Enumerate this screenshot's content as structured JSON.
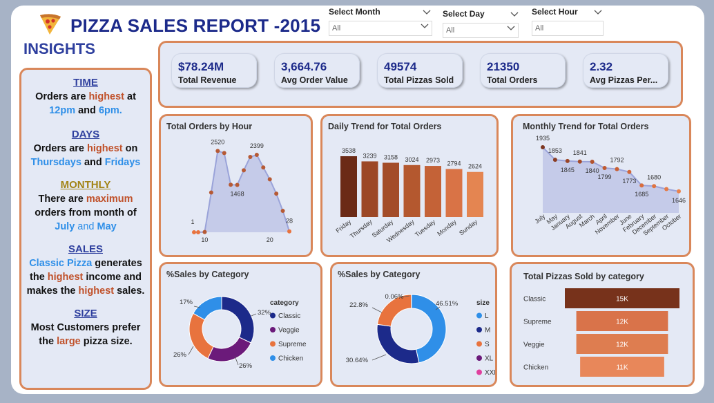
{
  "header": {
    "title": "PIZZA SALES REPORT -2015",
    "slicers": [
      {
        "label": "Select Month",
        "value": "All"
      },
      {
        "label": "Select Day",
        "value": "All"
      },
      {
        "label": "Select Hour",
        "value": "All"
      }
    ]
  },
  "insights": {
    "heading": "INSIGHTS",
    "time": {
      "h": "TIME",
      "a": "Orders are ",
      "b": "highest",
      "c": " at",
      "d": "12pm",
      "e": " and ",
      "f": "6pm."
    },
    "days": {
      "h": "DAYS ",
      "a": "Orders are ",
      "b": "highest",
      "c": " on",
      "d": "Thursdays",
      "e": " and ",
      "f": "Fridays"
    },
    "monthly": {
      "h": "MONTHLY",
      "a": "There are ",
      "b": "maximum",
      "c": "orders from month of",
      "d": "July",
      "e": " and ",
      "f": "May"
    },
    "sales": {
      "h": "SALES",
      "a": "Classic Pizza",
      "b": " generates",
      "c": "the ",
      "d": "highest",
      "e": " income and",
      "f": "makes the ",
      "g": "highest",
      "i": " sales."
    },
    "size": {
      "h": "SIZE",
      "a": "Most Customers prefer",
      "b": "the ",
      "c": "large",
      "d": " pizza size."
    }
  },
  "kpis": [
    {
      "value": "$78.24M",
      "label": "Total Revenue"
    },
    {
      "value": "3,664.76",
      "label": "Avg Order Value"
    },
    {
      "value": "49574",
      "label": "Total Pizzas Sold"
    },
    {
      "value": "21350",
      "label": "Total Orders"
    },
    {
      "value": "2.32",
      "label": "Avg Pizzas Per..."
    }
  ],
  "colors": {
    "navy": "#1c2a8a",
    "orange_border": "#d9875a",
    "panel_bg": "#e4e9f5"
  },
  "chart_data": [
    {
      "id": "hour",
      "type": "area",
      "title": "Total Orders by Hour",
      "x": [
        9,
        10,
        11,
        12,
        13,
        14,
        15,
        16,
        17,
        18,
        19,
        20,
        21,
        22,
        23
      ],
      "values": [
        1,
        8,
        1231,
        2520,
        2455,
        1472,
        1468,
        1920,
        2336,
        2399,
        2009,
        1642,
        1198,
        663,
        28
      ],
      "data_labels": [
        {
          "x": 9,
          "text": "1"
        },
        {
          "x": 12,
          "text": "2520"
        },
        {
          "x": 15,
          "text": "1468"
        },
        {
          "x": 18,
          "text": "2399"
        },
        {
          "x": 23,
          "text": "28"
        }
      ],
      "x_ticks": [
        "10",
        "20"
      ],
      "ylim": [
        0,
        2700
      ]
    },
    {
      "id": "daily",
      "type": "bar",
      "title": "Daily Trend for Total Orders",
      "categories": [
        "Friday",
        "Thursday",
        "Saturday",
        "Wednesday",
        "Tuesday",
        "Monday",
        "Sunday"
      ],
      "values": [
        3538,
        3239,
        3158,
        3024,
        2973,
        2794,
        2624
      ],
      "labels": [
        "3538",
        "3239",
        "3158",
        "3024",
        "2973",
        "2794",
        "2624"
      ],
      "colors": [
        "#6b2a16",
        "#9c4726",
        "#a34c29",
        "#b4582f",
        "#c46237",
        "#d97346",
        "#e48551"
      ]
    },
    {
      "id": "monthly",
      "type": "area",
      "title": "Monthly Trend for Total Orders",
      "categories": [
        "July",
        "May",
        "January",
        "August",
        "March",
        "April",
        "November",
        "June",
        "February",
        "December",
        "September",
        "October"
      ],
      "values": [
        1935,
        1853,
        1845,
        1841,
        1840,
        1799,
        1792,
        1773,
        1685,
        1680,
        1661,
        1646
      ],
      "labels": [
        "1935",
        "1853",
        "1845",
        "1841",
        "1840",
        "1799",
        "1792",
        "1773",
        "1685",
        "1680",
        "",
        "1646"
      ],
      "ylim": [
        1000,
        2000
      ]
    },
    {
      "id": "cat",
      "type": "pie",
      "title": "%Sales by Category",
      "legend_title": "category",
      "series": [
        {
          "name": "Classic",
          "value": 32,
          "color": "#1c2a8a"
        },
        {
          "name": "Veggie",
          "value": 25,
          "color": "#6b1a7a"
        },
        {
          "name": "Supreme",
          "value": 26,
          "color": "#e8733e"
        },
        {
          "name": "Chicken",
          "value": 17,
          "color": "#2f8fe8"
        }
      ],
      "slice_labels": [
        "32%",
        "26%",
        "26%",
        "17%"
      ]
    },
    {
      "id": "size",
      "type": "pie",
      "title": "%Sales by Category",
      "legend_title": "size",
      "series": [
        {
          "name": "L",
          "value": 46.51,
          "color": "#2f8fe8"
        },
        {
          "name": "M",
          "value": 30.64,
          "color": "#1c2a8a"
        },
        {
          "name": "S",
          "value": 22.8,
          "color": "#e8733e"
        },
        {
          "name": "XL",
          "value": 0.06,
          "color": "#6b1a7a"
        },
        {
          "name": "XXL",
          "value": 0.0,
          "color": "#e0409e"
        }
      ],
      "slice_labels": [
        "46.51%",
        "30.64%",
        "22.8%",
        "0.06%",
        ""
      ]
    },
    {
      "id": "funnel",
      "type": "bar",
      "title": "Total Pizzas Sold by category",
      "categories": [
        "Classic",
        "Supreme",
        "Veggie",
        "Chicken"
      ],
      "values": [
        15000,
        12000,
        12000,
        11000
      ],
      "labels": [
        "15K",
        "12K",
        "12K",
        "11K"
      ],
      "colors": [
        "#77321b",
        "#d9734a",
        "#de7d50",
        "#e8875a"
      ]
    }
  ]
}
